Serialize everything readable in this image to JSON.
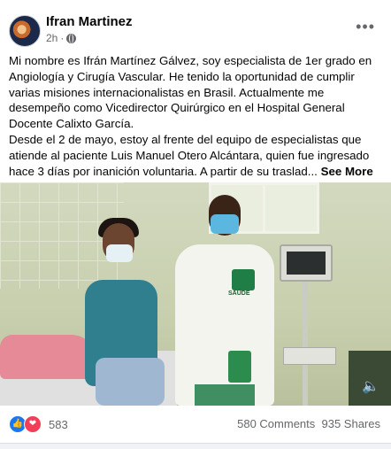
{
  "post": {
    "author": "Ifran Martinez",
    "time": "2h",
    "privacy_icon": "globe-icon",
    "menu_icon": "more-dots-icon",
    "text_p1": "Mi nombre es Ifrán Martínez Gálvez, soy especialista de 1er grado en Angiología y Cirugía Vascular. He tenido la oportunidad de cumplir varias misiones internacionalistas en Brasil. Actualmente me desempeño como Vicedirector Quirúrgico en el Hospital General Docente Calixto García.",
    "text_p2": "Desde el 2 de mayo, estoy al frente del equipo de especialistas que atiende al paciente Luis Manuel Otero Alcántara, quien fue ingresado hace 3 días por inanición voluntaria. A partir de su traslad...",
    "see_more": "See More",
    "photo_label": "SAÚDE",
    "volume_icon": "volume-icon"
  },
  "footer": {
    "reaction_icons": [
      "like-icon",
      "love-icon"
    ],
    "reaction_count": "583",
    "comments": "580 Comments",
    "shares": "935 Shares"
  },
  "colors": {
    "like": "#1877f2",
    "love": "#f33e58",
    "meta_text": "#65676b"
  }
}
